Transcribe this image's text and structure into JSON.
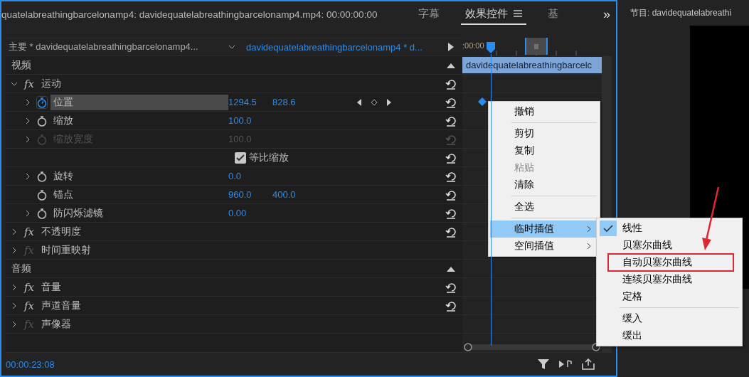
{
  "panel_header": {
    "title": "quatelabreathingbarcelonamp4: davidequatelabreathingbarcelonamp4.mp4: 00:00:00:00",
    "tabs": [
      {
        "label": "字幕",
        "selected": false
      },
      {
        "label": "效果控件",
        "selected": true
      },
      {
        "label": "基",
        "selected": false
      }
    ],
    "overflow": "»"
  },
  "effect_controls": {
    "source_label": "主要 * davidequatelabreathingbarcelonamp4...",
    "clip_label": "davidequatelabreathingbarcelonamp4 * d...",
    "time_label": ":00:00",
    "clip_bar": "davidequatelabreathingbarcelc",
    "sections": [
      {
        "label": "视频",
        "effects": [
          {
            "badge": "fx",
            "label": "运动",
            "enabled": true,
            "expanded": true,
            "has_reset": true,
            "properties": [
              {
                "kind": "value",
                "label": "位置",
                "expandable": true,
                "animated": true,
                "highlighted": true,
                "enabled": true,
                "values": [
                  "1294.5",
                  "828.6"
                ],
                "keyframe_nav": true
              },
              {
                "kind": "value",
                "label": "缩放",
                "expandable": true,
                "animated": false,
                "highlighted": false,
                "enabled": true,
                "values": [
                  "100.0"
                ],
                "keyframe_nav": false
              },
              {
                "kind": "value",
                "label": "缩放宽度",
                "expandable": true,
                "animated": false,
                "highlighted": false,
                "enabled": false,
                "values": [
                  "100.0"
                ],
                "keyframe_nav": false
              },
              {
                "kind": "checkbox",
                "label": "等比缩放",
                "checked": true
              },
              {
                "kind": "value",
                "label": "旋转",
                "expandable": true,
                "animated": false,
                "highlighted": false,
                "enabled": true,
                "values": [
                  "0.0"
                ],
                "keyframe_nav": false
              },
              {
                "kind": "value",
                "label": "锚点",
                "expandable": false,
                "animated": false,
                "highlighted": false,
                "enabled": true,
                "values": [
                  "960.0",
                  "400.0"
                ],
                "keyframe_nav": false
              },
              {
                "kind": "value",
                "label": "防闪烁滤镜",
                "expandable": true,
                "animated": false,
                "highlighted": false,
                "enabled": true,
                "values": [
                  "0.00"
                ],
                "keyframe_nav": false
              }
            ]
          },
          {
            "badge": "fx",
            "label": "不透明度",
            "enabled": true,
            "expanded": false,
            "has_reset": true
          },
          {
            "badge": "fx",
            "label": "时间重映射",
            "enabled": false,
            "expanded": false,
            "has_reset": false
          }
        ]
      },
      {
        "label": "音频",
        "effects": [
          {
            "badge": "fx",
            "label": "音量",
            "enabled": true,
            "expanded": false,
            "has_reset": true
          },
          {
            "badge": "fx",
            "label": "声道音量",
            "enabled": true,
            "expanded": false,
            "has_reset": true
          },
          {
            "badge": "fx",
            "label": "声像器",
            "enabled": false,
            "expanded": false,
            "has_reset": false
          }
        ]
      }
    ],
    "timecode": "00:00:23:08"
  },
  "context_menu": {
    "items": [
      {
        "kind": "item",
        "label": "撤销",
        "disabled": false,
        "selected": false,
        "submenu": false
      },
      {
        "kind": "separator"
      },
      {
        "kind": "item",
        "label": "剪切",
        "disabled": false,
        "selected": false,
        "submenu": false
      },
      {
        "kind": "item",
        "label": "复制",
        "disabled": false,
        "selected": false,
        "submenu": false
      },
      {
        "kind": "item",
        "label": "粘贴",
        "disabled": true,
        "selected": false,
        "submenu": false
      },
      {
        "kind": "item",
        "label": "清除",
        "disabled": false,
        "selected": false,
        "submenu": false
      },
      {
        "kind": "separator"
      },
      {
        "kind": "item",
        "label": "全选",
        "disabled": false,
        "selected": false,
        "submenu": false
      },
      {
        "kind": "separator"
      },
      {
        "kind": "item",
        "label": "临时插值",
        "disabled": false,
        "selected": true,
        "submenu": true
      },
      {
        "kind": "item",
        "label": "空间插值",
        "disabled": false,
        "selected": false,
        "submenu": true
      }
    ]
  },
  "submenu": {
    "items": [
      {
        "kind": "item",
        "label": "线性",
        "checked": true,
        "annotated": false
      },
      {
        "kind": "item",
        "label": "贝塞尔曲线",
        "checked": false,
        "annotated": false
      },
      {
        "kind": "item",
        "label": "自动贝塞尔曲线",
        "checked": false,
        "annotated": true
      },
      {
        "kind": "item",
        "label": "连续贝塞尔曲线",
        "checked": false,
        "annotated": false
      },
      {
        "kind": "item",
        "label": "定格",
        "checked": false,
        "annotated": false
      },
      {
        "kind": "separator"
      },
      {
        "kind": "item",
        "label": "缓入",
        "checked": false,
        "annotated": false
      },
      {
        "kind": "item",
        "label": "缓出",
        "checked": false,
        "annotated": false
      }
    ]
  },
  "program_monitor": {
    "title": "节目: davidequatelabreathi"
  }
}
